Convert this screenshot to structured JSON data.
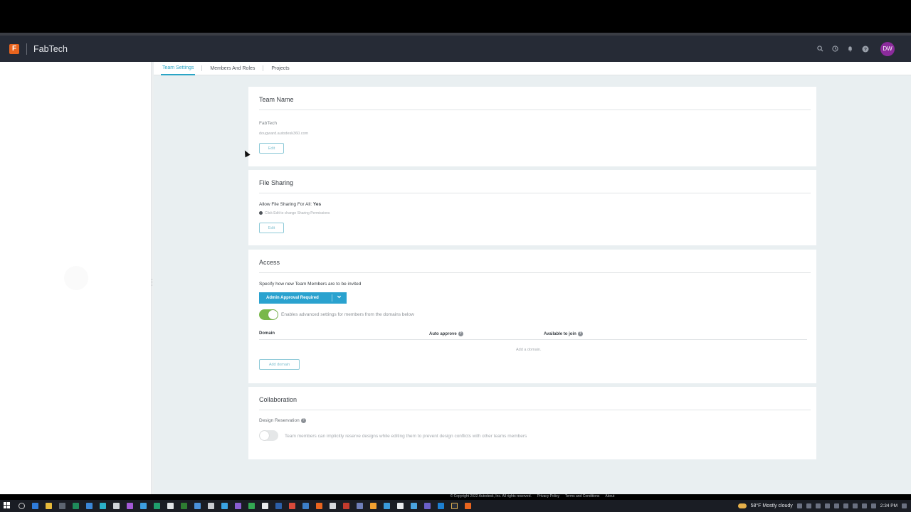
{
  "app": {
    "logo_letter": "F",
    "title": "FabTech",
    "avatar_initials": "DW",
    "brand_color": "#e8641e",
    "avatar_color": "#8b2b9c"
  },
  "header_icons": [
    "search-icon",
    "history-icon",
    "bell-icon",
    "help-icon"
  ],
  "tabs": [
    {
      "label": "Team Settings",
      "active": true
    },
    {
      "label": "Members And Roles",
      "active": false
    },
    {
      "label": "Projects",
      "active": false
    }
  ],
  "team_name": {
    "title": "Team Name",
    "name": "FabTech",
    "url": "dougward.autodesk360.com",
    "edit_label": "Edit"
  },
  "file_sharing": {
    "title": "File Sharing",
    "label": "Allow File Sharing For All:",
    "value": "Yes",
    "hint": "Click Edit to change Sharing Permissions",
    "edit_label": "Edit"
  },
  "access": {
    "title": "Access",
    "description": "Specify how new Team Members are to be invited",
    "dropdown_value": "Admin Approval Required",
    "toggle_on": true,
    "toggle_label": "Enables advanced settings for members from the domains below",
    "columns": [
      "Domain",
      "Auto approve",
      "Available to join"
    ],
    "empty_text": "Add a domain.",
    "add_domain_label": "Add domain",
    "accent": "#2aa2cf"
  },
  "collaboration": {
    "title": "Collaboration",
    "reservation_label": "Design Reservation",
    "toggle_on": false,
    "toggle_label": "Team members can implicitly reserve designs while editing them to prevent design conflicts with other teams members"
  },
  "footer": {
    "copyright": "© Copyright 2022 Autodesk, Inc. All rights reserved.",
    "links": [
      "Privacy Policy",
      "Terms and Conditions",
      "About"
    ]
  },
  "taskbar": {
    "weather": "58°F  Mostly cloudy",
    "time": "2:34 PM"
  }
}
